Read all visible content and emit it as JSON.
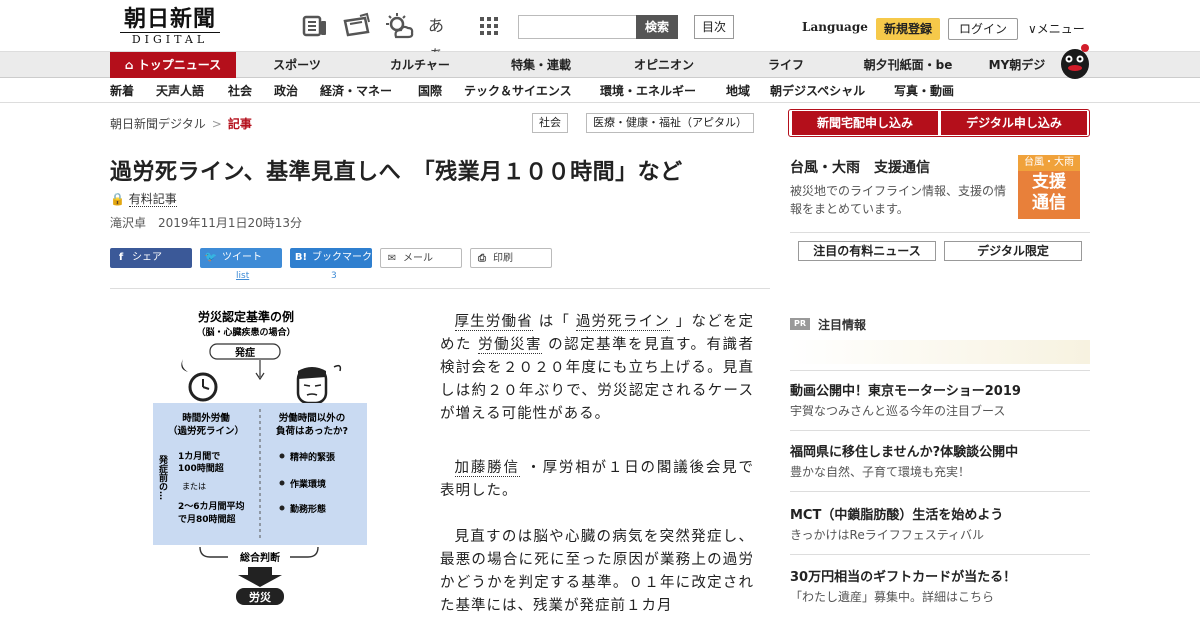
{
  "header": {
    "logo_main": "朝日新聞",
    "logo_sub": "DIGITAL",
    "font_size_icon_label": "あぁ",
    "search_button": "検索",
    "index_button": "目次",
    "language": "Language",
    "register": "新規登録",
    "login": "ログイン",
    "menu": "メニュー"
  },
  "nav_primary": [
    "トップニュース",
    "スポーツ",
    "カルチャー",
    "特集・連載",
    "オピニオン",
    "ライフ",
    "朝夕刊紙面・be",
    "MY朝デジ"
  ],
  "nav_secondary": [
    "新着",
    "天声人語",
    "社会",
    "政治",
    "経済・マネー",
    "国際",
    "テック＆サイエンス",
    "環境・エネルギー",
    "地域",
    "朝デジスペシャル",
    "写真・動画"
  ],
  "breadcrumb": {
    "home": "朝日新聞デジタル",
    "sep": ">",
    "current": "記事"
  },
  "tags": [
    "社会",
    "医療・健康・福祉（アピタル）"
  ],
  "article": {
    "title": "過労死ライン、基準見直しへ　「残業月１００時間」など",
    "paid_label": "有料記事",
    "author": "滝沢卓",
    "date": "2019年11月1日20時13分",
    "share": {
      "facebook": "シェア",
      "tweet": "ツイート",
      "tweet_count": "list",
      "bookmark": "ブックマーク",
      "bookmark_count": "3",
      "mail": "メール",
      "print": "印刷"
    },
    "p1_a": "厚生労働省",
    "p1_b": " は「 ",
    "p1_c": "過労死ライン",
    "p1_d": " 」などを定めた ",
    "p1_e": "労働災害",
    "p1_f": " の認定基準を見直す。有識者検討会を２０２０年度にも立ち上げる。見直しは約２０年ぶりで、労災認定されるケースが増える可能性がある。",
    "p2_a": "加藤勝信",
    "p2_b": " ・厚労相が１日の閣議後会見で表明した。",
    "p3": "見直すのは脳や心臓の病気を突然発症し、最悪の場合に死に至った原因が業務上の過労かどうかを判定する基準。０１年に改定された基準には、残業が発症前１カ月"
  },
  "diagram": {
    "title": "労災認定基準の例",
    "subtitle": "（脳・心臓疾患の場合）",
    "onset": "発症",
    "left_head": "時間外労働\n（過労死ライン）",
    "side_label": "発症前の…",
    "left_1": "1カ月間で\n100時間超",
    "left_or": "または",
    "left_2": "2～6カ月間平均\nで月80時間超",
    "right_head": "労働時間以外の\n負荷はあったか?",
    "right_items": [
      "精神的緊張",
      "作業環境",
      "勤務形態"
    ],
    "judgement": "総合判断",
    "result": "労災"
  },
  "sidebar": {
    "subscribe_paper": "新聞宅配申し込み",
    "subscribe_digital": "デジタル申し込み",
    "feature_title": "台風・大雨　支援通信",
    "feature_desc": "被災地でのライフライン情報、支援の情報をまとめています。",
    "badge_top": "台風・大雨",
    "badge_main_1": "支援",
    "badge_main_2": "通信",
    "btn_paid_news": "注目の有料ニュース",
    "btn_digital_only": "デジタル限定",
    "pr_badge": "PR",
    "pr_title": "注目情報",
    "promos": [
      {
        "title": "動画公開中！東京モーターショー2019",
        "sub": "宇賀なつみさんと巡る今年の注目ブース"
      },
      {
        "title": "福岡県に移住しませんか?体験談公開中",
        "sub": "豊かな自然、子育て環境も充実！"
      },
      {
        "title": "MCT（中鎖脂肪酸）生活を始めよう",
        "sub": "きっかけはReライフフェスティバル"
      },
      {
        "title": "30万円相当のギフトカードが当たる！",
        "sub": "「わたし遺産」募集中。詳細はこちら"
      }
    ]
  },
  "colors": {
    "brand_red": "#b40f1b",
    "register_yellow": "#f6c94a",
    "facebook": "#3b5998",
    "twitter": "#3e8bd6",
    "hatena": "#2f7fcf",
    "diagram_blue": "#c9daf2"
  }
}
